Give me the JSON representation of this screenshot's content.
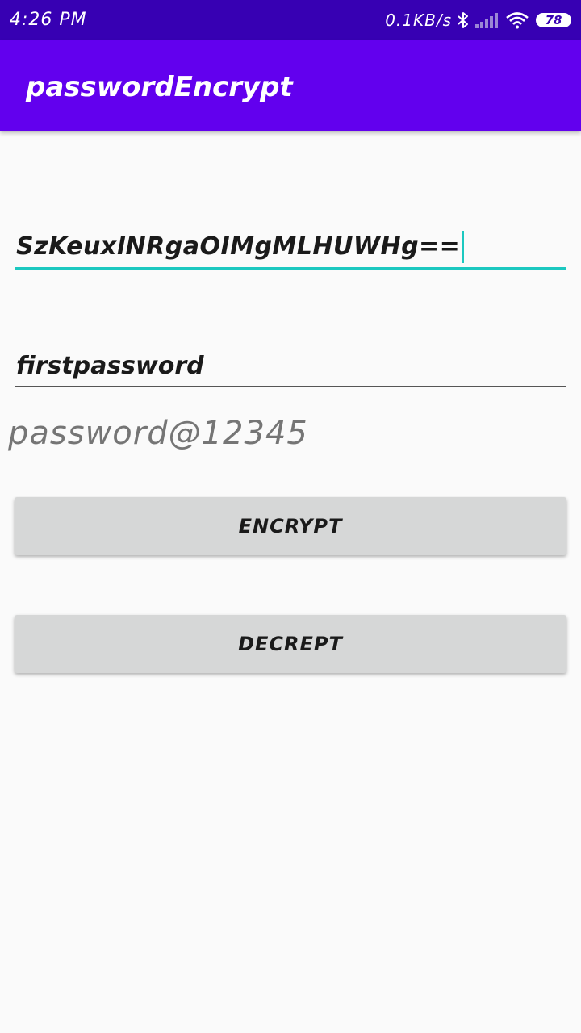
{
  "status_bar": {
    "time": "4:26 PM",
    "net_speed": "0.1KB/s",
    "battery": "78",
    "icons": [
      "bluetooth-icon",
      "signal-icon",
      "wifi-icon",
      "battery-icon"
    ]
  },
  "app_bar": {
    "title": "passwordEncrypt"
  },
  "form": {
    "encrypted_value": "SzKeuxlNRgaOIMgMLHUWHg==",
    "plain_value": "firstpassword",
    "decrypted_text": "password@12345"
  },
  "buttons": {
    "encrypt_label": "ENCRYPT",
    "decrypt_label": "DECREPT"
  },
  "colors": {
    "status_bar": "#3700b3",
    "app_bar": "#6200ee",
    "accent": "#1cc8c0",
    "button": "#d6d7d7",
    "background": "#fafafa"
  }
}
